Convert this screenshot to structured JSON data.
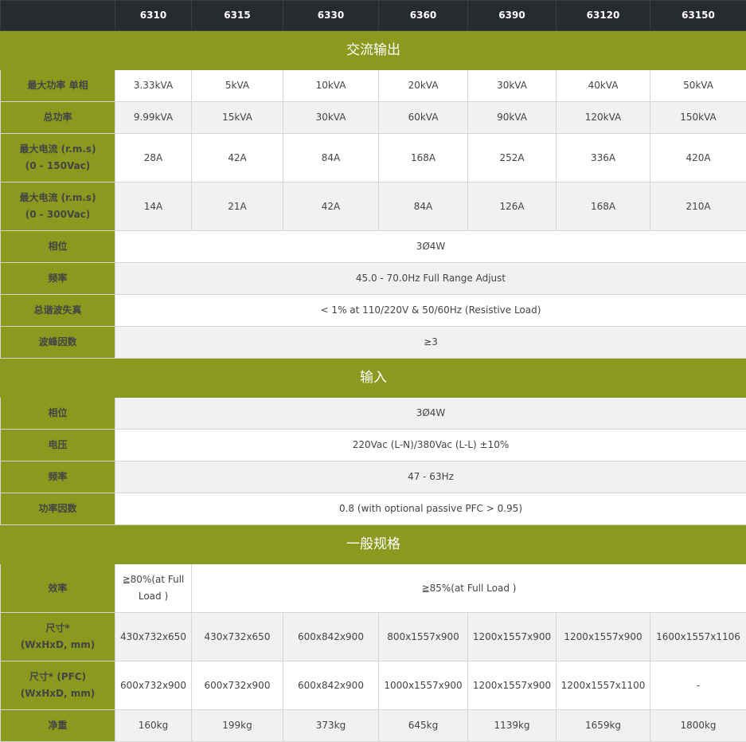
{
  "models": [
    "6310",
    "6315",
    "6330",
    "6360",
    "6390",
    "63120",
    "63150"
  ],
  "sections": {
    "ac_output": "交流输出",
    "input": "输入",
    "general": "一般规格"
  },
  "ac_output": {
    "max_power_single": {
      "label": "最大功率 单相",
      "values": [
        "3.33kVA",
        "5kVA",
        "10kVA",
        "20kVA",
        "30kVA",
        "40kVA",
        "50kVA"
      ]
    },
    "total_power": {
      "label": "总功率",
      "values": [
        "9.99kVA",
        "15kVA",
        "30kVA",
        "60kVA",
        "90kVA",
        "120kVA",
        "150kVA"
      ]
    },
    "max_current_150": {
      "label_line1": "最大电流 (r.m.s)",
      "label_line2": "(0 - 150Vac)",
      "values": [
        "28A",
        "42A",
        "84A",
        "168A",
        "252A",
        "336A",
        "420A"
      ]
    },
    "max_current_300": {
      "label_line1": "最大电流 (r.m.s)",
      "label_line2": "(0 - 300Vac)",
      "values": [
        "14A",
        "21A",
        "42A",
        "84A",
        "126A",
        "168A",
        "210A"
      ]
    },
    "phase": {
      "label": "相位",
      "value": "3Ø4W"
    },
    "frequency": {
      "label": "频率",
      "value": "45.0 - 70.0Hz Full Range Adjust"
    },
    "thd": {
      "label": "总谐波失真",
      "value": "< 1% at 110/220V & 50/60Hz (Resistive Load)"
    },
    "crest_factor": {
      "label": "波峰因数",
      "value": "≥3"
    }
  },
  "input": {
    "phase": {
      "label": "相位",
      "value": "3Ø4W"
    },
    "voltage": {
      "label": "电压",
      "value": "220Vac (L-N)/380Vac (L-L) ±10%"
    },
    "frequency": {
      "label": "频率",
      "value": "47 - 63Hz"
    },
    "power_factor": {
      "label": "功率因数",
      "value": "0.8 (with optional passive PFC > 0.95)"
    }
  },
  "general": {
    "efficiency": {
      "label": "效率",
      "first_line1": "≧80%(at Full",
      "first_line2": "Load )",
      "rest": "≧85%(at Full Load )"
    },
    "dimension": {
      "label_line1": "尺寸*",
      "label_line2": "(WxHxD, mm)",
      "values": [
        "430x732x650",
        "430x732x650",
        "600x842x900",
        "800x1557x900",
        "1200x1557x900",
        "1200x1557x900",
        "1600x1557x1106"
      ]
    },
    "dimension_pfc": {
      "label_line1": "尺寸* (PFC)",
      "label_line2": "(WxHxD, mm)",
      "values": [
        "600x732x900",
        "600x732x900",
        "600x842x900",
        "1000x1557x900",
        "1200x1557x900",
        "1200x1557x1100",
        "-"
      ]
    },
    "weight": {
      "label": "净重",
      "values": [
        "160kg",
        "199kg",
        "373kg",
        "645kg",
        "1139kg",
        "1659kg",
        "1800kg"
      ]
    }
  },
  "colors": {
    "header_bg": "#272a2f",
    "accent": "#8a9a1f",
    "row_alt": "#f1f1f1"
  }
}
